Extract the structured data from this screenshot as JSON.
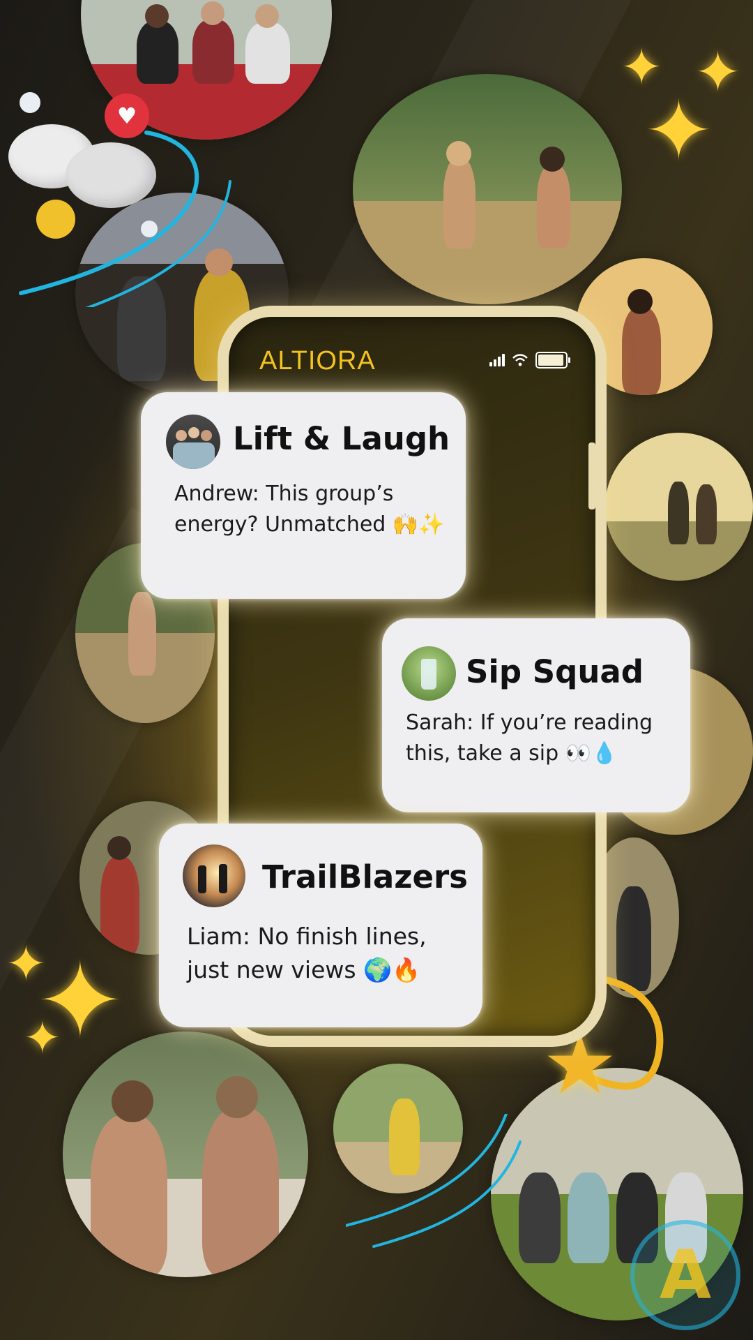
{
  "app": {
    "brand": "ALTIORA"
  },
  "status_bar": {
    "signal_icon": "signal-icon",
    "wifi_icon": "wifi-icon",
    "battery_icon": "battery-icon",
    "battery_level": 0.95
  },
  "chats": [
    {
      "group": "Lift & Laugh",
      "message": "Andrew: This group’s energy? Unmatched 🙌✨",
      "avatar_icon": "group-photo-avatar"
    },
    {
      "group": "Sip Squad",
      "message": "Sarah: If you’re reading this, take a sip 👀💧",
      "avatar_icon": "water-glass-avatar"
    },
    {
      "group": "TrailBlazers",
      "message": "Liam: No finish lines, just new views 🌍🔥",
      "avatar_icon": "hikers-sunset-avatar"
    }
  ],
  "decor": {
    "sparkle_glyph": "✦",
    "star_glyph": "★",
    "heart_glyph": "♥",
    "accent_color": "#f2c320",
    "swoosh_color": "#22b5e0",
    "logo_letter": "A"
  }
}
